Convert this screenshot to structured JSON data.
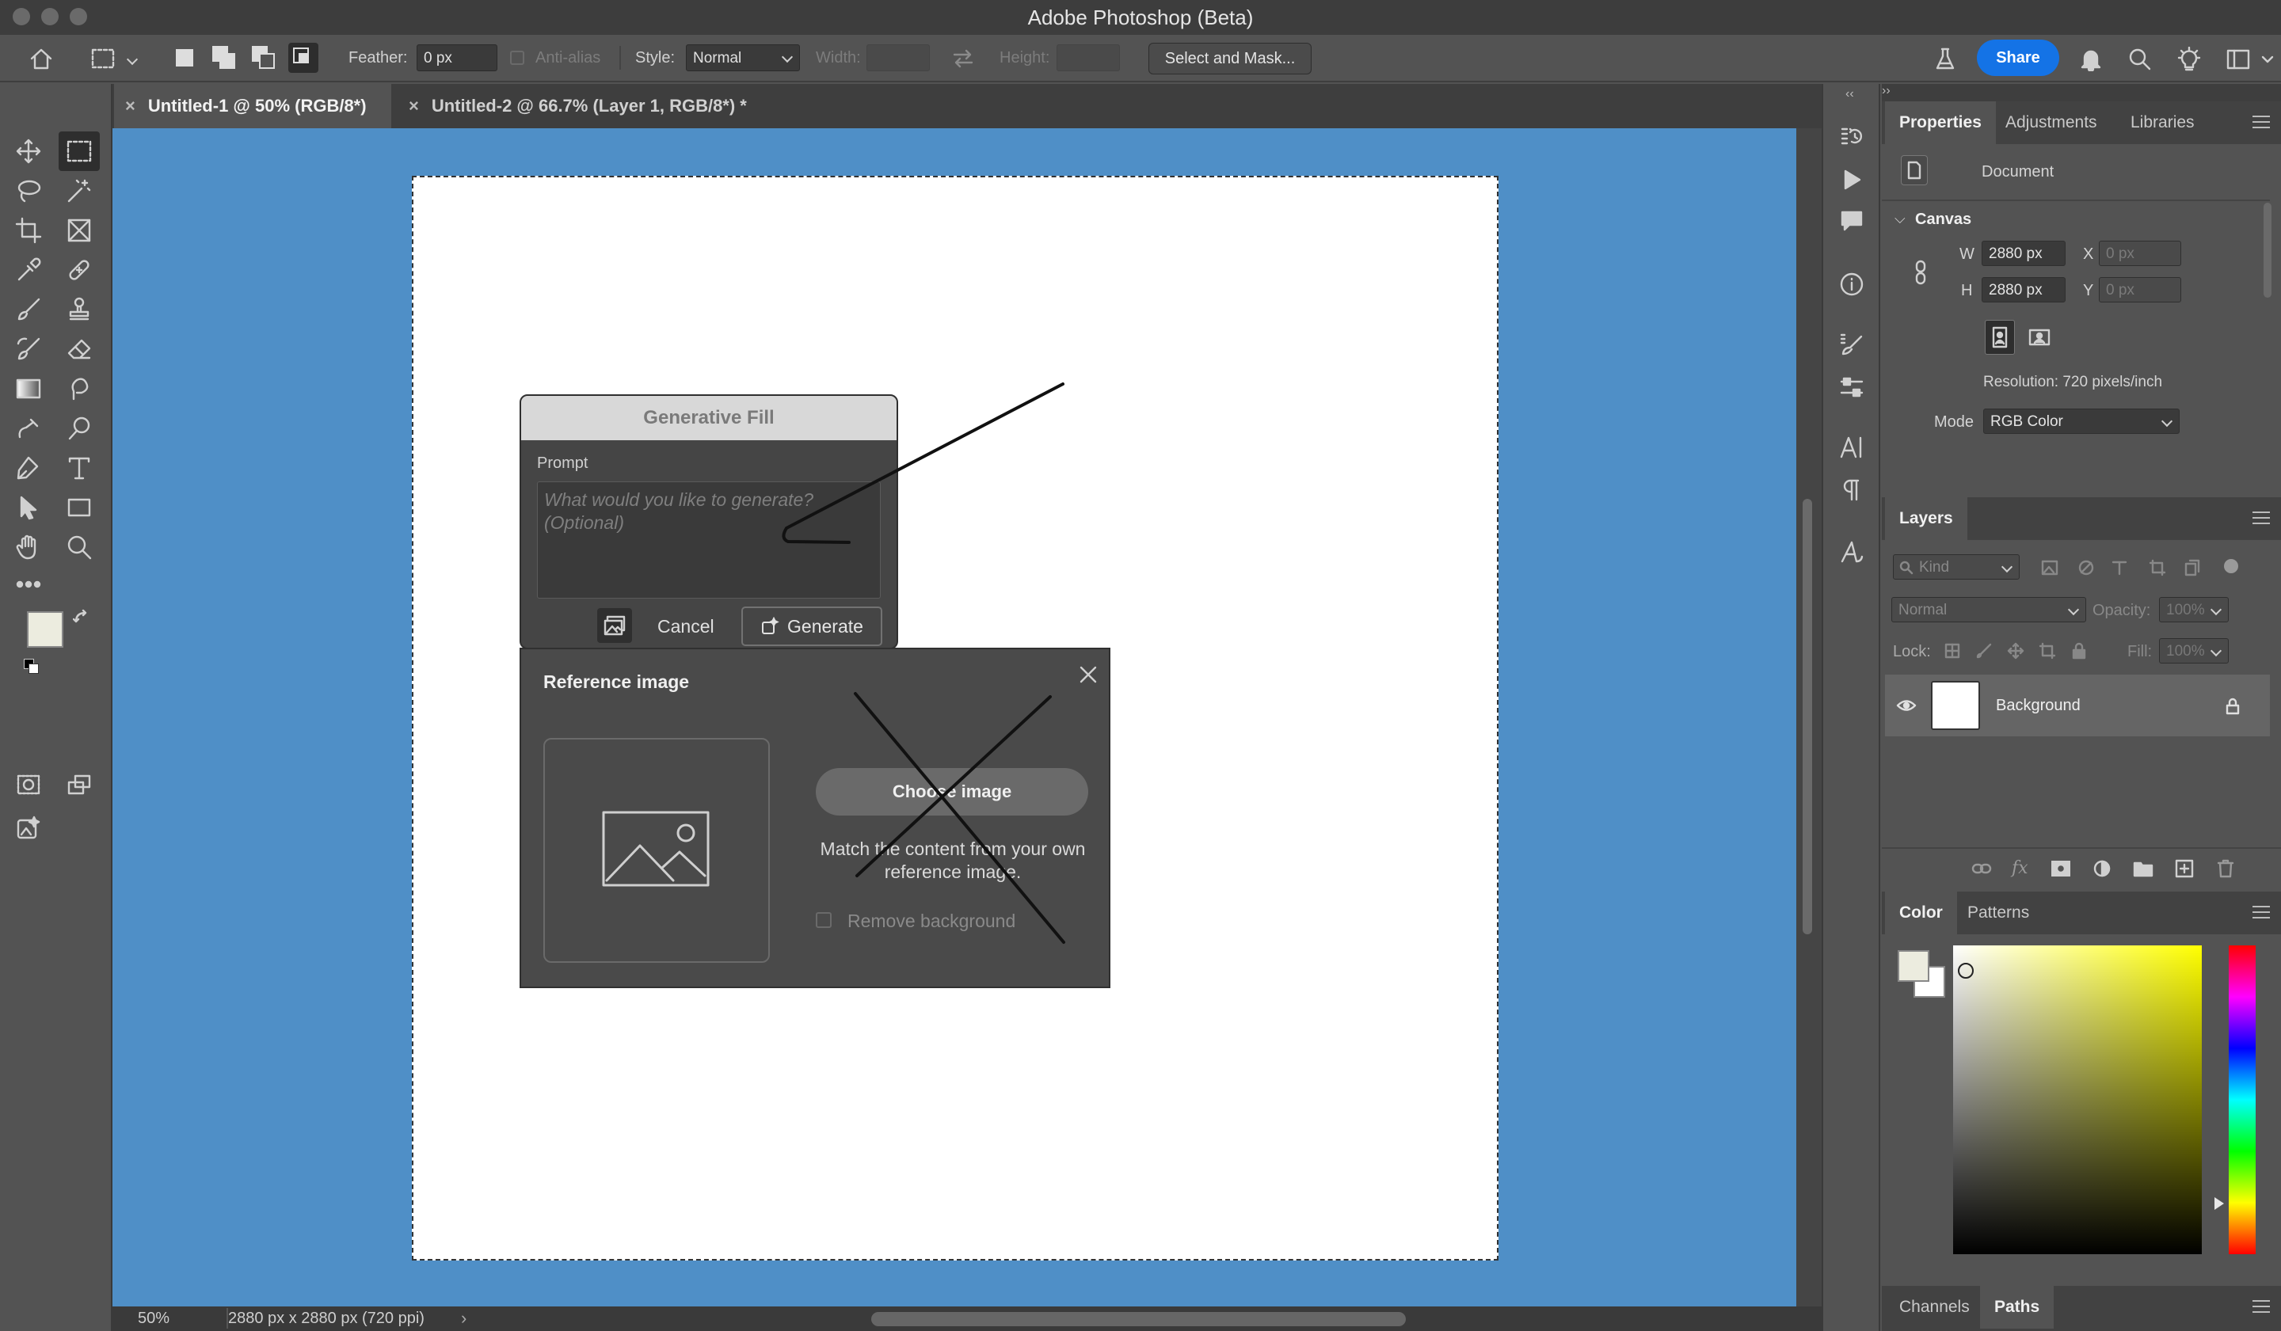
{
  "app": {
    "title": "Adobe Photoshop (Beta)"
  },
  "options_bar": {
    "feather_label": "Feather:",
    "feather_value": "0 px",
    "antialias_label": "Anti-alias",
    "style_label": "Style:",
    "style_value": "Normal",
    "width_label": "Width:",
    "height_label": "Height:",
    "select_mask_label": "Select and Mask...",
    "share_label": "Share"
  },
  "tabs": [
    {
      "label": "Untitled-1 @ 50% (RGB/8*)",
      "active": true
    },
    {
      "label": "Untitled-2 @ 66.7% (Layer 1, RGB/8*) *",
      "active": false
    }
  ],
  "generative_fill": {
    "title": "Generative Fill",
    "prompt_label": "Prompt",
    "prompt_placeholder": "What would you like to generate? (Optional)",
    "cancel_label": "Cancel",
    "generate_label": "Generate"
  },
  "reference_image": {
    "title": "Reference image",
    "choose_label": "Choose image",
    "help_text": "Match the content from your own reference image.",
    "remove_bg_label": "Remove background"
  },
  "properties_panel": {
    "tabs": [
      "Properties",
      "Adjustments",
      "Libraries"
    ],
    "doc_label": "Document",
    "section_label": "Canvas",
    "w_label": "W",
    "w_value": "2880 px",
    "h_label": "H",
    "h_value": "2880 px",
    "x_label": "X",
    "x_value": "0 px",
    "y_label": "Y",
    "y_value": "0 px",
    "resolution": "Resolution: 720 pixels/inch",
    "mode_label": "Mode",
    "mode_value": "RGB Color"
  },
  "layers_panel": {
    "tab": "Layers",
    "kind_placeholder": "Kind",
    "blend_value": "Normal",
    "opacity_label": "Opacity:",
    "opacity_value": "100%",
    "lock_label": "Lock:",
    "fill_label": "Fill:",
    "fill_value": "100%",
    "layers": [
      {
        "name": "Background",
        "visible": true,
        "locked": true
      }
    ]
  },
  "color_panel": {
    "tabs": [
      "Color",
      "Patterns"
    ]
  },
  "bottom_panel": {
    "tabs": [
      "Channels",
      "Paths"
    ]
  },
  "status": {
    "zoom": "50%",
    "doc_info": "2880 px x 2880 px (720 ppi)"
  },
  "colors": {
    "canvas_bg": "#4f8fc7",
    "accent": "#1473e6"
  }
}
